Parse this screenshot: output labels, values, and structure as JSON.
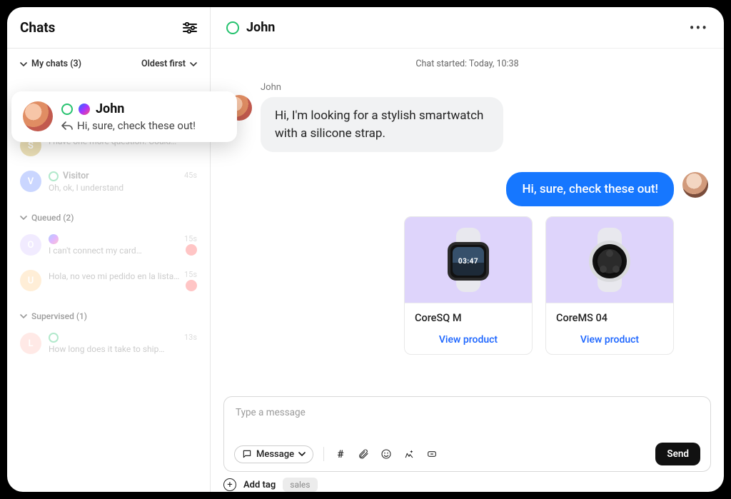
{
  "sidebar": {
    "title": "Chats",
    "my_chats_label": "My chats (3)",
    "sort_label": "Oldest first",
    "sections": {
      "queued_label": "Queued (2)",
      "supervised_label": "Supervised (1)"
    },
    "highlighted": {
      "name": "John",
      "preview": "Hi, sure, check these out!"
    },
    "items": [
      {
        "initial": "S",
        "name": "",
        "preview": "I have one more question. Could…",
        "time": ""
      },
      {
        "initial": "V",
        "name": "Visitor",
        "preview": "Oh, ok, I understand",
        "time": "45s"
      }
    ],
    "queued": [
      {
        "initial": "O",
        "name": "",
        "preview": "I can't connect my card…",
        "time": "15s"
      },
      {
        "initial": "U",
        "name": "",
        "preview": "Hola, no veo mi pedido en la lista…",
        "time": "15s"
      }
    ],
    "supervised": [
      {
        "initial": "L",
        "name": "",
        "preview": "How long does it take to ship…",
        "time": "13s"
      }
    ]
  },
  "main": {
    "title": "John",
    "chat_started": "Chat started: Today, 10:38",
    "in_message": {
      "name": "John",
      "text": "Hi, I'm looking for a stylish smartwatch with a silicone strap."
    },
    "out_message": "Hi, sure, check these out!",
    "watch_time": "03:47",
    "products": [
      {
        "name": "CoreSQ M",
        "link_label": "View product"
      },
      {
        "name": "CoreMS 04",
        "link_label": "View product"
      }
    ]
  },
  "composer": {
    "placeholder": "Type a message",
    "mode_label": "Message",
    "send_label": "Send",
    "add_tag_label": "Add tag",
    "sample_tag": "sales"
  }
}
